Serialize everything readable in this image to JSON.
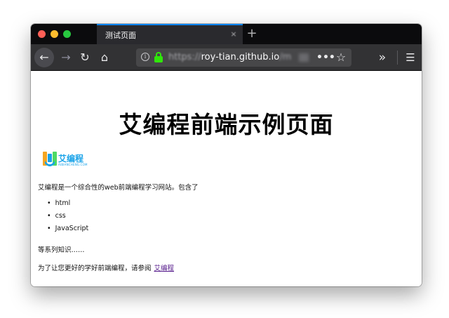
{
  "browser": {
    "tab": {
      "title": "测试页面",
      "close_icon": "×"
    },
    "new_tab_icon": "+",
    "toolbar": {
      "back_icon": "←",
      "forward_icon": "→",
      "reload_icon": "↻",
      "home_icon": "⌂",
      "page_actions_icon": "•••",
      "star_icon": "☆",
      "overflow_icon": "»",
      "menu_icon": "☰"
    },
    "url": {
      "scheme": "https://",
      "host": "roy-tian.github.io",
      "tail": "/m"
    }
  },
  "page": {
    "title": "艾编程前端示例页面",
    "logo": {
      "text": "艾编程",
      "subtext": "AIBIANCHENG.COM"
    },
    "intro": "艾编程是一个综合性的web前端编程学习网站。包含了",
    "list": [
      "html",
      "css",
      "JavaScript"
    ],
    "more": "等系列知识……",
    "refer_text": "为了让您更好的学好前端编程，请参阅",
    "refer_link": "艾编程"
  },
  "colors": {
    "tab_accent": "#0a84ff",
    "lock_green": "#30e60b",
    "logo_blue": "#1aa3e8",
    "visited_link": "#551a8b"
  }
}
